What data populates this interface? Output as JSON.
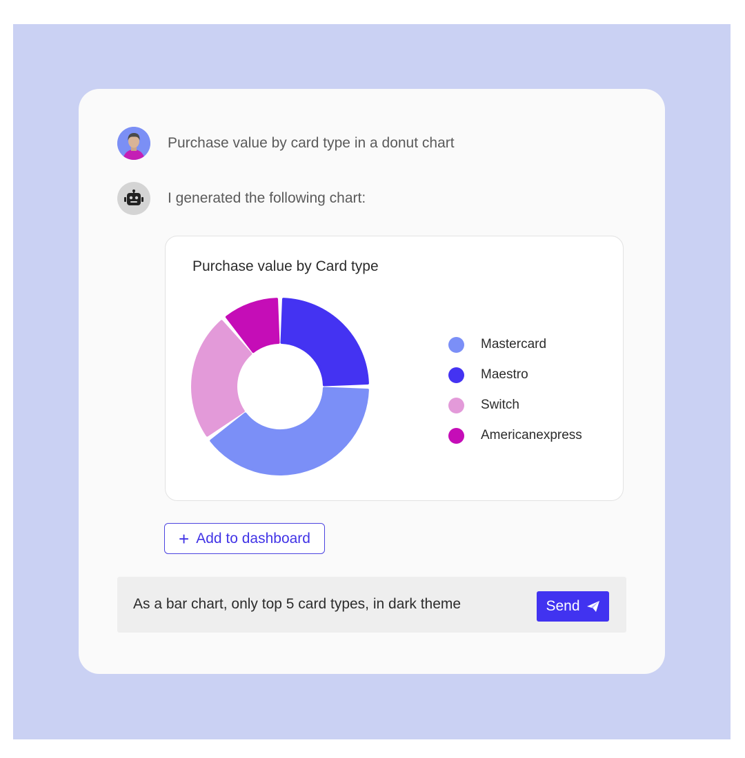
{
  "conversation": {
    "user_message": "Purchase value by card type in a donut chart",
    "bot_message": "I generated the following chart:"
  },
  "chart_data": {
    "type": "donut",
    "title": "Purchase value by Card type",
    "categories": [
      "Mastercard",
      "Maestro",
      "Switch",
      "Americanexpress"
    ],
    "values": [
      40,
      25,
      24,
      11
    ],
    "colors": [
      "#7b8ff7",
      "#4433f2",
      "#e39ad9",
      "#c50db7"
    ],
    "legend_position": "right"
  },
  "actions": {
    "add_to_dashboard_label": "Add to dashboard",
    "add_icon": "plus-icon"
  },
  "composer": {
    "input_value": "As a bar chart, only top 5 card types, in dark theme",
    "send_label": "Send",
    "send_icon": "paper-plane-icon"
  }
}
